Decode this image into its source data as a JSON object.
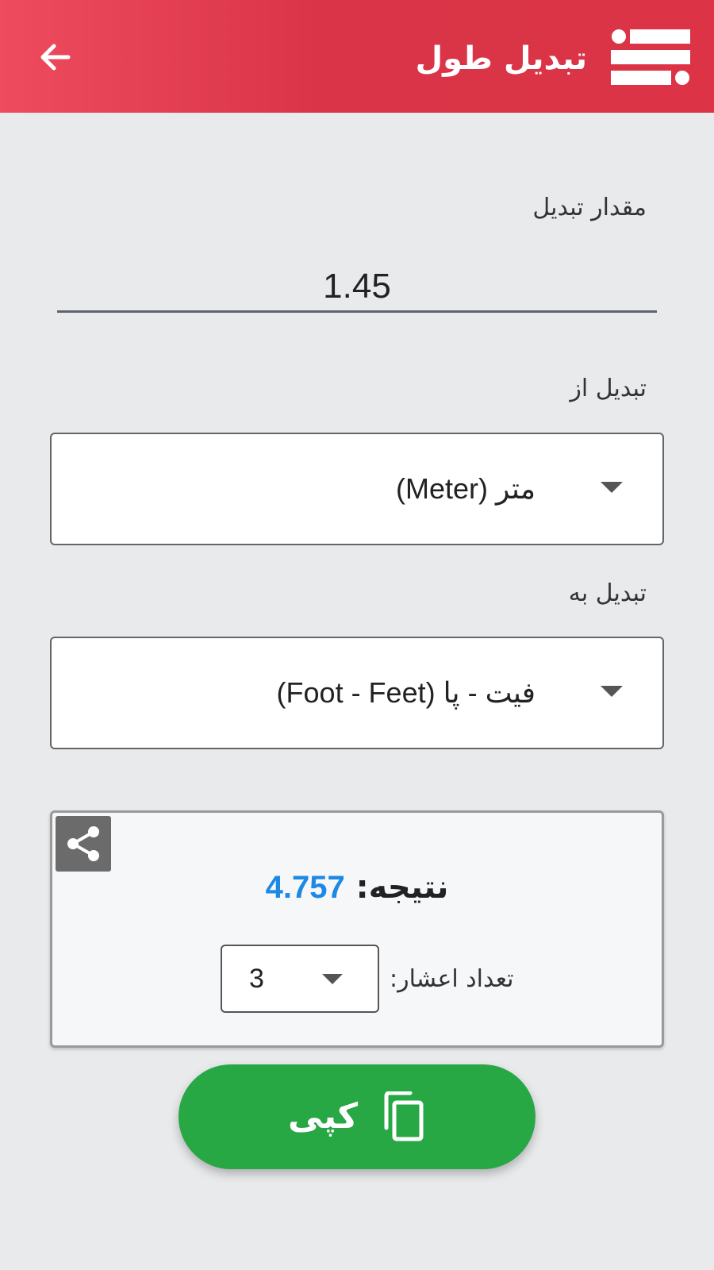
{
  "appbar": {
    "title": "تبدیل طول",
    "back_icon": "arrow-left-icon",
    "logo_icon": "app-logo-icon",
    "color": "#dc3446"
  },
  "amount": {
    "label": "مقدار تبدیل",
    "value": "1.45"
  },
  "convert_from": {
    "label": "تبدیل از",
    "selected": "متر (Meter)"
  },
  "convert_to": {
    "label": "تبدیل به",
    "selected": "فیت - پا (Foot - Feet)"
  },
  "result": {
    "label": "نتیجه:",
    "value": "4.757",
    "value_color": "#1e88e5",
    "share_icon": "share-icon",
    "decimals_label": "تعداد اعشار:",
    "decimals_value": "3"
  },
  "copy_button": {
    "label": "کپی",
    "icon": "copy-icon",
    "color": "#28a745"
  }
}
